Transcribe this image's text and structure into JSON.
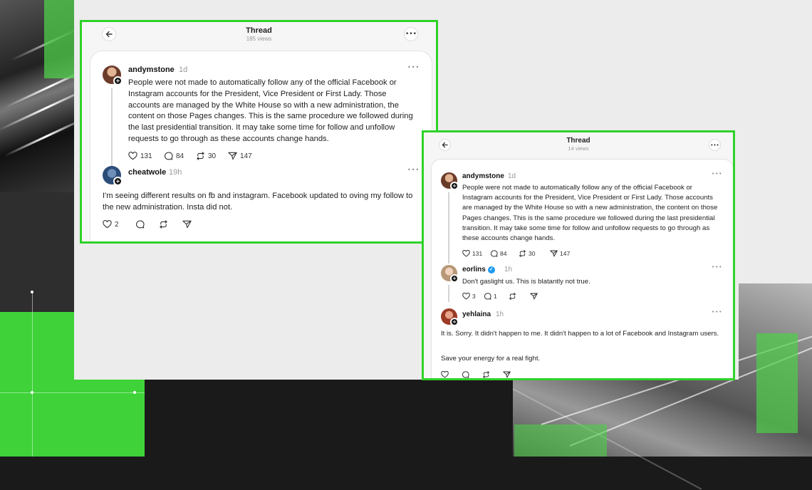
{
  "shot1": {
    "title": "Thread",
    "views": "185 views",
    "post1": {
      "username": "andymstone",
      "time": "1d",
      "text": "People were not made to automatically follow any of the official Facebook or Instagram accounts for the President, Vice President or First Lady. Those accounts are managed by the White House so with a new administration, the content on those Pages changes. This is the same procedure we followed during the last presidential transition. It may take some time for follow and unfollow requests to go through as these accounts change hands.",
      "likes": "131",
      "replies": "84",
      "reposts": "30",
      "shares": "147"
    },
    "post2": {
      "username": "cheatwole",
      "time": "19h",
      "text": "I'm seeing different results on fb and instagram. Facebook updated to oving my follow to the new administration. Insta did not.",
      "likes": "2"
    }
  },
  "shot2": {
    "title": "Thread",
    "views": "14 views",
    "post1": {
      "username": "andymstone",
      "time": "1d",
      "text": "People were not made to automatically follow any of the official Facebook or Instagram accounts for the President, Vice President or First Lady. Those accounts are managed by the White House so with a new administration, the content on those Pages changes. This is the same procedure we followed during the last presidential transition. It may take some time for follow and unfollow requests to go through as these accounts change hands.",
      "likes": "131",
      "replies": "84",
      "reposts": "30",
      "shares": "147"
    },
    "post2": {
      "username": "eorlins",
      "time": "1h",
      "text": "Don't gaslight us. This is blatantly not true.",
      "likes": "3",
      "replies": "1"
    },
    "post3": {
      "username": "yehlaina",
      "time": "1h",
      "text1": "It is. Sorry. It didn't happen to me. It didn't happen to a lot of Facebook and Instagram users.",
      "text2": "Save your energy for a real fight."
    }
  },
  "icons": {
    "back": "arrow-left-icon",
    "more": "ellipsis-icon",
    "like": "heart-icon",
    "reply": "speech-bubble-icon",
    "repost": "repost-icon",
    "share": "paper-plane-icon",
    "verified": "verified-badge-icon",
    "follow": "plus-icon"
  },
  "colors": {
    "highlight_border": "#2fd22a",
    "accent_green": "#3fd239",
    "verified_blue": "#1d9bf0"
  }
}
